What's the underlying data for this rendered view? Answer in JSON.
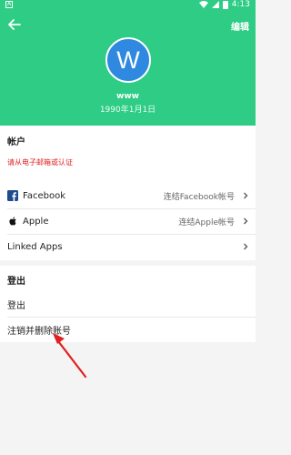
{
  "statusbar": {
    "time": "4:13",
    "left_glyph": "A"
  },
  "header": {
    "back_icon": "arrow-left-icon",
    "edit_label": "编辑",
    "avatar_letter": "W",
    "username": "www",
    "birthday": "1990年1月1日",
    "bg_color": "#2ecc85",
    "avatar_color": "#2f89e0"
  },
  "account": {
    "title": "帐户",
    "notice": "请从电子邮箱或认证",
    "rows": [
      {
        "icon": "facebook-icon",
        "label": "Facebook",
        "value": "连结Facebook帐号"
      },
      {
        "icon": "apple-icon",
        "label": "Apple",
        "value": "连结Apple帐号"
      },
      {
        "icon": "",
        "label": "Linked Apps",
        "value": ""
      }
    ]
  },
  "logout": {
    "title": "登出",
    "rows": [
      {
        "label": "登出"
      },
      {
        "label": "注销并删除账号"
      }
    ]
  },
  "annotation": {
    "arrow_color": "#e02020"
  }
}
